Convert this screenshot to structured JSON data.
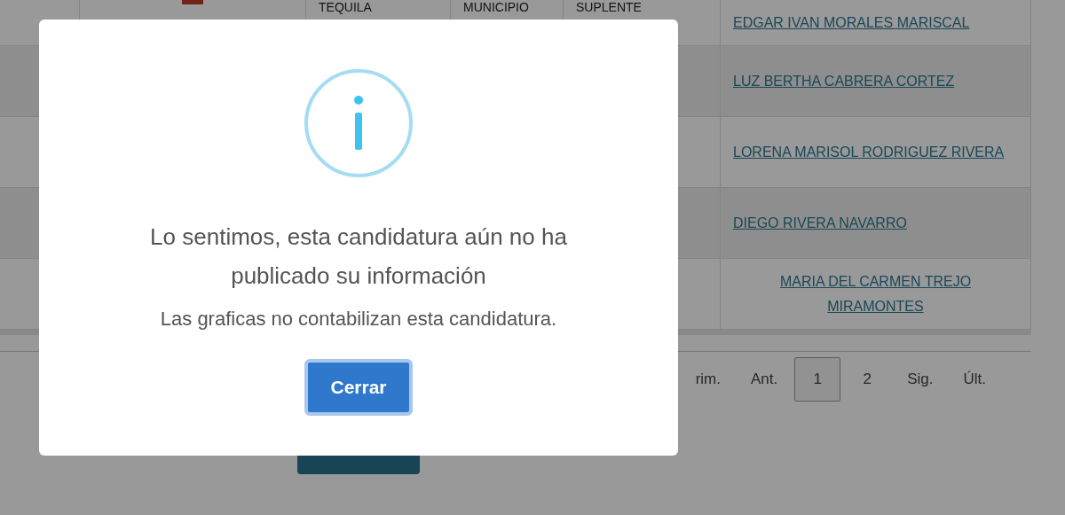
{
  "table": {
    "rows": [
      {
        "column_3": "TEQUILA",
        "column_4": "MUNICIPIO",
        "column_5": "SUPLENTE",
        "name": "EDGAR IVAN MORALES MARISCAL"
      },
      {
        "name": "LUZ BERTHA CABRERA CORTEZ"
      },
      {
        "name": "LORENA MARISOL RODRIGUEZ RIVERA"
      },
      {
        "name": "DIEGO RIVERA NAVARRO"
      },
      {
        "name": "MARIA DEL CARMEN TREJO MIRAMONTES"
      }
    ]
  },
  "pagination": [
    {
      "label": "rim.",
      "selected": false
    },
    {
      "label": "Ant.",
      "selected": false
    },
    {
      "label": "1",
      "selected": true
    },
    {
      "label": "2",
      "selected": false
    },
    {
      "label": "Sig.",
      "selected": false
    },
    {
      "label": "Últ.",
      "selected": false
    }
  ],
  "modal": {
    "title": "Lo sentimos, esta candidatura aún no ha publicado su información",
    "text": "Las graficas no contabilizan esta candidatura.",
    "button": "Cerrar"
  }
}
